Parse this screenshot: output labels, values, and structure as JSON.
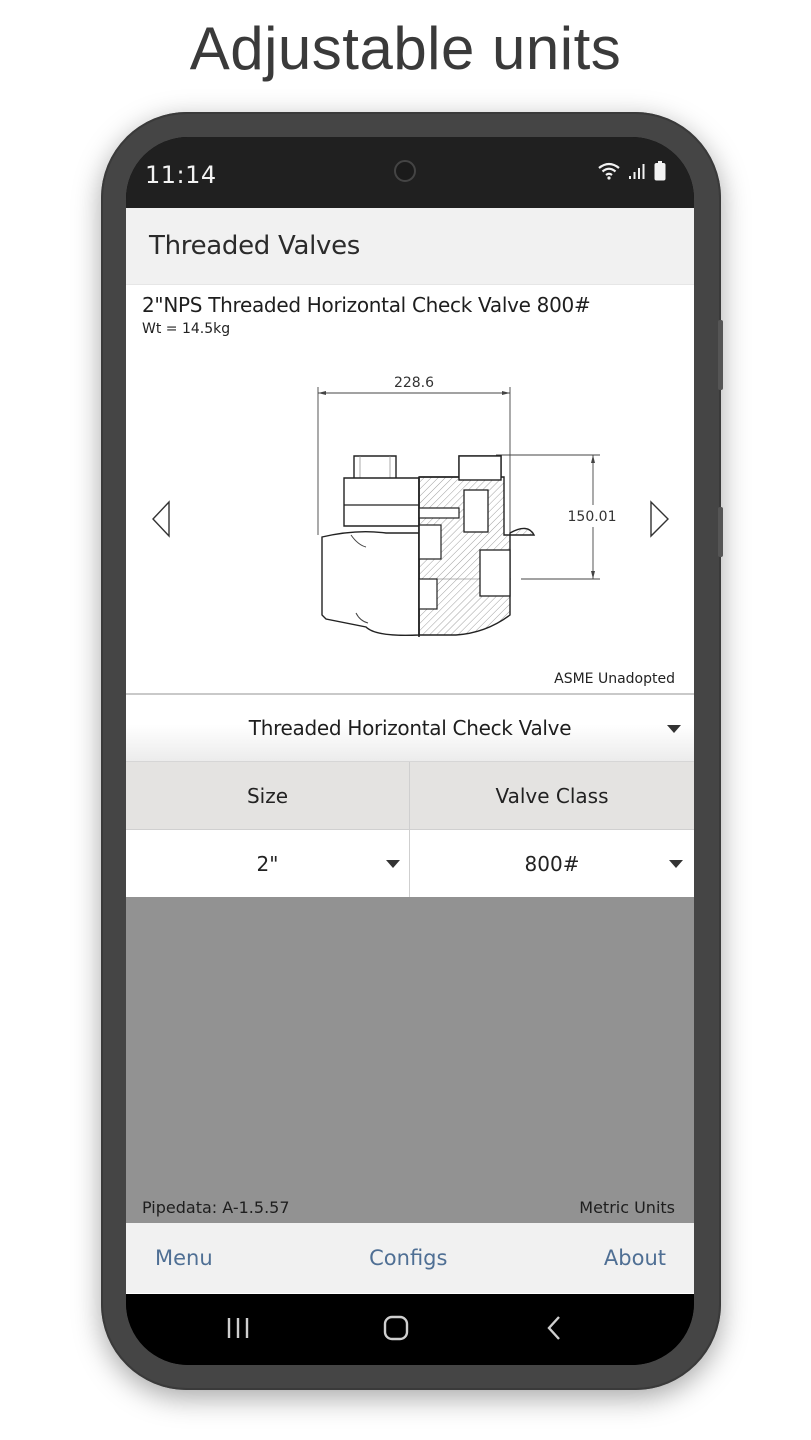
{
  "promo": {
    "title": "Adjustable units"
  },
  "status_bar": {
    "time": "11:14",
    "icons": [
      "wifi-icon",
      "signal-icon",
      "battery-icon"
    ]
  },
  "app": {
    "title": "Threaded Valves",
    "detail": {
      "title": "2\"NPS Threaded Horizontal Check Valve 800#",
      "weight": "Wt = 14.5kg",
      "dimension_width": "228.6",
      "dimension_height": "150.01",
      "standard_note": "ASME Unadopted",
      "prev_icon": "triangle-left-icon",
      "next_icon": "triangle-right-icon"
    },
    "valve_type": {
      "selected": "Threaded Horizontal Check Valve"
    },
    "grid": {
      "columns": [
        {
          "header": "Size",
          "value": "2\""
        },
        {
          "header": "Valve Class",
          "value": "800#"
        }
      ]
    },
    "footer": {
      "version": "Pipedata: A-1.5.57",
      "units": "Metric Units"
    },
    "tabs": [
      {
        "label": "Menu"
      },
      {
        "label": "Configs"
      },
      {
        "label": "About"
      }
    ],
    "colors": {
      "link": "#4f6f94",
      "header_bg": "#f1f1f1",
      "grid_header_bg": "#e4e3e1",
      "empty_area_bg": "#929292"
    }
  },
  "system_nav": {
    "buttons": [
      "recent-apps-icon",
      "home-icon",
      "back-icon"
    ]
  }
}
